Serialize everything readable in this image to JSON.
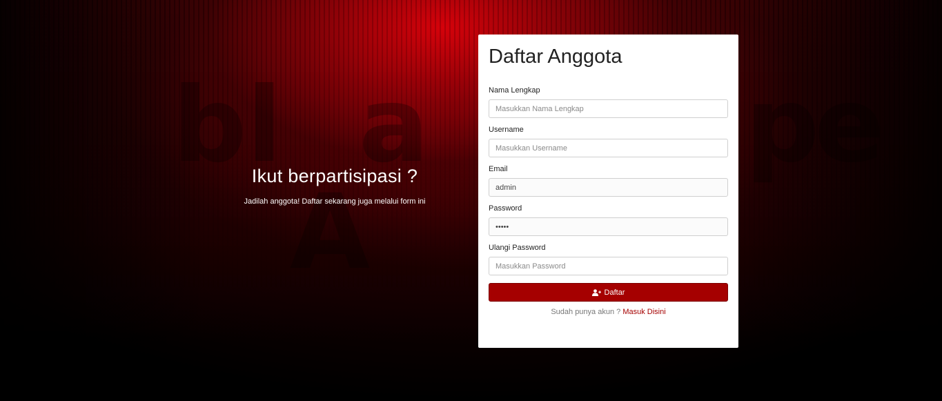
{
  "intro": {
    "title": "Ikut berpartisipasi ?",
    "subtitle": "Jadilah anggota! Daftar sekarang juga melalui form ini"
  },
  "form": {
    "title": "Daftar Anggota",
    "fields": [
      {
        "label": "Nama Lengkap",
        "placeholder": "Masukkan Nama Lengkap",
        "value": ""
      },
      {
        "label": "Username",
        "placeholder": "Masukkan Username",
        "value": ""
      },
      {
        "label": "Email",
        "placeholder": "",
        "value": "admin"
      },
      {
        "label": "Password",
        "placeholder": "",
        "value": "•••••"
      },
      {
        "label": "Ulangi Password",
        "placeholder": "Masukkan Password",
        "value": ""
      }
    ],
    "submit_label": "Daftar",
    "submit_icon": "user-plus-icon",
    "login_prompt": "Sudah punya akun ?",
    "login_link": "Masuk Disini"
  },
  "colors": {
    "accent": "#a50000",
    "background": "#1a0002"
  }
}
